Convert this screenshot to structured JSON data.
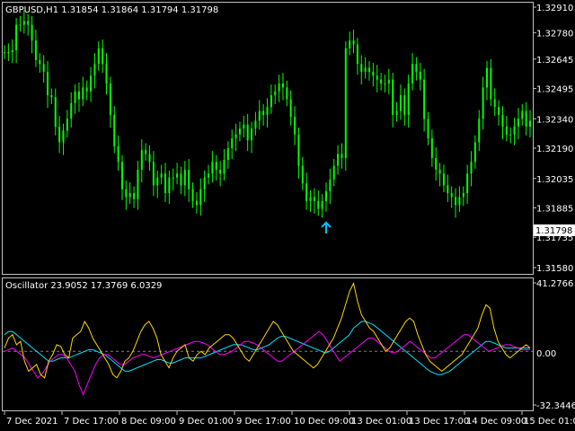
{
  "main_chart": {
    "symbol_header": "GBPUSD,H1  1.31854 1.31864 1.31794 1.31798",
    "price_ticks": [
      "1.32910",
      "1.32780",
      "1.32645",
      "1.32495",
      "1.32340",
      "1.32190",
      "1.32035",
      "1.31885",
      "1.31735",
      "1.31580"
    ],
    "current_price": "1.31798",
    "candle_color": "#00ff00",
    "arrow_color": "#00bfff",
    "arrow": {
      "bar_index": 82,
      "price": 1.31782
    },
    "price_range": [
      1.3158,
      1.3291
    ],
    "close_series": [
      1.3268,
      1.3268,
      1.3269,
      1.3282,
      1.3282,
      1.3284,
      1.3282,
      1.3274,
      1.3264,
      1.3262,
      1.3258,
      1.3246,
      1.3245,
      1.323,
      1.3222,
      1.3228,
      1.3234,
      1.3242,
      1.3248,
      1.3244,
      1.325,
      1.3248,
      1.3256,
      1.3262,
      1.327,
      1.3262,
      1.3252,
      1.3236,
      1.322,
      1.3212,
      1.3198,
      1.3194,
      1.3196,
      1.3193,
      1.3208,
      1.3218,
      1.3216,
      1.3212,
      1.32,
      1.3204,
      1.3206,
      1.3196,
      1.3204,
      1.3204,
      1.3206,
      1.32,
      1.3208,
      1.3198,
      1.3192,
      1.319,
      1.3198,
      1.3204,
      1.3206,
      1.3212,
      1.3208,
      1.3206,
      1.3213,
      1.3219,
      1.3224,
      1.3226,
      1.3229,
      1.3231,
      1.3223,
      1.3229,
      1.3233,
      1.3238,
      1.3236,
      1.324,
      1.3246,
      1.3248,
      1.3252,
      1.325,
      1.3244,
      1.3235,
      1.3226,
      1.321,
      1.3201,
      1.3192,
      1.3194,
      1.3192,
      1.3188,
      1.3192,
      1.3197,
      1.3203,
      1.321,
      1.3216,
      1.3214,
      1.327,
      1.3274,
      1.3272,
      1.3262,
      1.3258,
      1.326,
      1.3258,
      1.3256,
      1.3254,
      1.3252,
      1.3252,
      1.3254,
      1.3236,
      1.3238,
      1.3246,
      1.3236,
      1.3252,
      1.3262,
      1.3258,
      1.3254,
      1.3234,
      1.3224,
      1.3214,
      1.3208,
      1.3206,
      1.32,
      1.3196,
      1.3194,
      1.319,
      1.3194,
      1.3196,
      1.3206,
      1.3212,
      1.3222,
      1.3234,
      1.325,
      1.326,
      1.3244,
      1.324,
      1.3236,
      1.323,
      1.3226,
      1.3226,
      1.323,
      1.3234,
      1.3238,
      1.323,
      1.3233
    ]
  },
  "oscillator": {
    "header": "Oscillator 23.9052 17.3769 6.0329",
    "ticks": {
      "top": "41.2766",
      "zero": "0.00",
      "bottom": "-32.3446"
    },
    "range": [
      -32.3446,
      41.2766
    ],
    "colors": {
      "yellow": "#ffd700",
      "cyan": "#00e5ff",
      "magenta": "#ff00ff",
      "zero_line": "#808080"
    },
    "yellow_series": [
      2,
      8,
      10,
      4,
      6,
      -6,
      -12,
      -10,
      -8,
      -14,
      -16,
      -6,
      -2,
      4,
      3,
      -2,
      -4,
      8,
      10,
      12,
      18,
      14,
      8,
      4,
      0,
      -4,
      -8,
      -14,
      -16,
      -12,
      -6,
      -4,
      0,
      6,
      12,
      16,
      18,
      14,
      8,
      -2,
      -6,
      -10,
      -4,
      0,
      2,
      4,
      -4,
      -6,
      -2,
      0,
      -2,
      2,
      4,
      6,
      8,
      10,
      10,
      8,
      4,
      0,
      -4,
      -6,
      -2,
      2,
      6,
      10,
      14,
      18,
      16,
      12,
      8,
      4,
      0,
      -2,
      -4,
      -6,
      -8,
      -10,
      -8,
      -4,
      0,
      4,
      8,
      14,
      20,
      28,
      36,
      41,
      30,
      22,
      18,
      14,
      12,
      8,
      4,
      0,
      2,
      6,
      10,
      14,
      18,
      20,
      18,
      10,
      4,
      -2,
      -6,
      -8,
      -10,
      -12,
      -10,
      -8,
      -6,
      -4,
      -2,
      2,
      6,
      10,
      14,
      22,
      28,
      26,
      14,
      6,
      2,
      -2,
      -4,
      -2,
      0,
      2,
      4,
      2
    ],
    "cyan_series": [
      10,
      12,
      12,
      10,
      8,
      6,
      4,
      2,
      0,
      -2,
      -4,
      -6,
      -6,
      -5,
      -4,
      -4,
      -4,
      -3,
      -2,
      -1,
      0,
      1,
      1,
      0,
      -1,
      -2,
      -4,
      -6,
      -8,
      -10,
      -12,
      -12,
      -11,
      -10,
      -9,
      -8,
      -7,
      -6,
      -5,
      -5,
      -6,
      -7,
      -7,
      -6,
      -5,
      -4,
      -4,
      -4,
      -4,
      -4,
      -3,
      -2,
      -1,
      0,
      1,
      2,
      3,
      4,
      4,
      4,
      3,
      2,
      1,
      1,
      2,
      3,
      4,
      6,
      8,
      9,
      9,
      8,
      7,
      6,
      5,
      4,
      3,
      2,
      1,
      0,
      -1,
      0,
      2,
      4,
      6,
      8,
      10,
      14,
      16,
      18,
      18,
      17,
      16,
      14,
      12,
      10,
      8,
      6,
      4,
      2,
      0,
      -2,
      -4,
      -6,
      -8,
      -10,
      -12,
      -13,
      -14,
      -14,
      -13,
      -12,
      -10,
      -8,
      -6,
      -4,
      -2,
      0,
      2,
      4,
      6,
      6,
      5,
      4,
      3,
      2,
      2,
      2,
      2,
      2,
      2,
      2
    ],
    "magenta_series": [
      0,
      1,
      2,
      0,
      -2,
      -4,
      -8,
      -12,
      -16,
      -14,
      -10,
      -6,
      -4,
      -2,
      -2,
      -4,
      -8,
      -12,
      -20,
      -26,
      -20,
      -14,
      -8,
      -4,
      -2,
      -2,
      -4,
      -6,
      -8,
      -8,
      -6,
      -4,
      -3,
      -2,
      -2,
      -3,
      -4,
      -3,
      -2,
      -1,
      0,
      1,
      2,
      3,
      4,
      5,
      6,
      6,
      5,
      4,
      2,
      0,
      -2,
      -2,
      -1,
      0,
      2,
      4,
      6,
      6,
      5,
      4,
      2,
      0,
      -2,
      -4,
      -6,
      -6,
      -4,
      -2,
      0,
      2,
      4,
      6,
      8,
      10,
      12,
      10,
      6,
      2,
      -2,
      -6,
      -4,
      -2,
      0,
      2,
      4,
      6,
      8,
      8,
      6,
      4,
      2,
      0,
      -1,
      0,
      2,
      4,
      6,
      4,
      2,
      0,
      -2,
      -4,
      -4,
      -2,
      0,
      2,
      4,
      6,
      8,
      10,
      10,
      8,
      6,
      4,
      2,
      0,
      1,
      2,
      3,
      4,
      4,
      3,
      2,
      1,
      1,
      1
    ]
  },
  "time_axis": {
    "labels": [
      "7 Dec 2021",
      "7 Dec 17:00",
      "8 Dec 09:00",
      "9 Dec 01:00",
      "9 Dec 17:00",
      "10 Dec 09:00",
      "13 Dec 01:00",
      "13 Dec 17:00",
      "14 Dec 09:00",
      "15 Dec 01:00"
    ]
  }
}
